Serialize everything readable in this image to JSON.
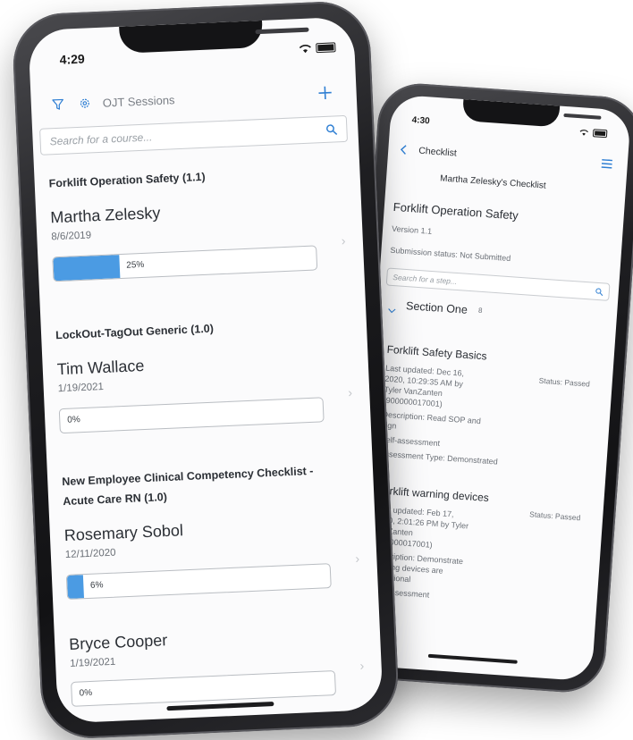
{
  "front": {
    "status_time": "4:29",
    "toolbar_title": "OJT Sessions",
    "filter_icon": "filter-icon",
    "settings_icon": "gear-icon",
    "add_icon": "plus-icon",
    "search_placeholder": "Search for a course...",
    "sessions": [
      {
        "course": "Forklift Operation Safety (1.1)",
        "name": "Martha Zelesky",
        "date": "8/6/2019",
        "progress": 0.25,
        "progress_label": "25%"
      },
      {
        "course": "LockOut-TagOut Generic (1.0)",
        "name": "Tim Wallace",
        "date": "1/19/2021",
        "progress": 0,
        "progress_label": "0%"
      },
      {
        "course": "New Employee Clinical Competency Checklist -",
        "course_line2": "Acute Care RN (1.0)",
        "name": "Rosemary Sobol",
        "date": "12/11/2020",
        "progress": 0.06,
        "progress_label": "6%"
      },
      {
        "name": "Bryce Cooper",
        "date": "1/19/2021",
        "progress": 0,
        "progress_label": "0%"
      }
    ],
    "accent_color": "#2f7fd3",
    "progress_color": "#4b9be3"
  },
  "back": {
    "status_time": "4:30",
    "nav_title": "Checklist",
    "back_icon": "chevron-left-icon",
    "menu_icon": "menu-icon",
    "checklist_owner": "Martha Zelesky's Checklist",
    "course_title": "Forklift Operation Safety",
    "version": "Version 1.1",
    "submission_status": "Submission status: Not Submitted",
    "search_placeholder": "Search for a step...",
    "section_title": "Section One",
    "section_count": "8",
    "steps": [
      {
        "title": "Forklift Safety Basics",
        "status": "Status: Passed",
        "updated": [
          "Last updated: Dec 16,",
          "2020, 10:29:35 AM by",
          "Tyler VanZanten",
          "(900000017001)"
        ],
        "description": [
          "Description: Read SOP and",
          "sign"
        ],
        "self_assessment": "Self-assessment",
        "assessment_type": "Assessment Type: Demonstrated"
      },
      {
        "title": "Forklift warning devices",
        "status": "Status: Passed",
        "updated": [
          "Last updated: Feb 17,",
          "2020, 2:01:26 PM by Tyler",
          "VanZanten",
          "(900000017001)"
        ],
        "description": [
          "Description: Demonstrate",
          "warning devices are",
          "operational"
        ],
        "self_assessment": "Self-assessment"
      }
    ]
  }
}
